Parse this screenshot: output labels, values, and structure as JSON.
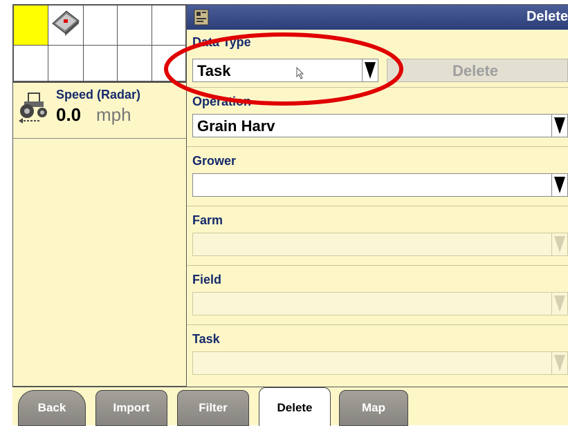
{
  "left_panel": {
    "speed": {
      "label": "Speed (Radar)",
      "value": "0.0",
      "unit": "mph"
    }
  },
  "right_panel": {
    "title": "Delete",
    "data_type": {
      "label": "Data Type",
      "value": "Task"
    },
    "delete_button": "Delete",
    "operation": {
      "label": "Operation",
      "value": "Grain Harv"
    },
    "grower": {
      "label": "Grower",
      "value": ""
    },
    "farm": {
      "label": "Farm",
      "value": ""
    },
    "field": {
      "label": "Field",
      "value": ""
    },
    "task": {
      "label": "Task",
      "value": ""
    }
  },
  "tabs": [
    {
      "label": "Back"
    },
    {
      "label": "Import"
    },
    {
      "label": "Filter"
    },
    {
      "label": "Delete",
      "active": true
    },
    {
      "label": "Map"
    }
  ],
  "colors": {
    "panel_bg": "#fdf7c8",
    "title_bar": "#2c3e78",
    "label_text": "#162a6b",
    "annotation": "#e00000",
    "active_cell": "#ffff00"
  }
}
